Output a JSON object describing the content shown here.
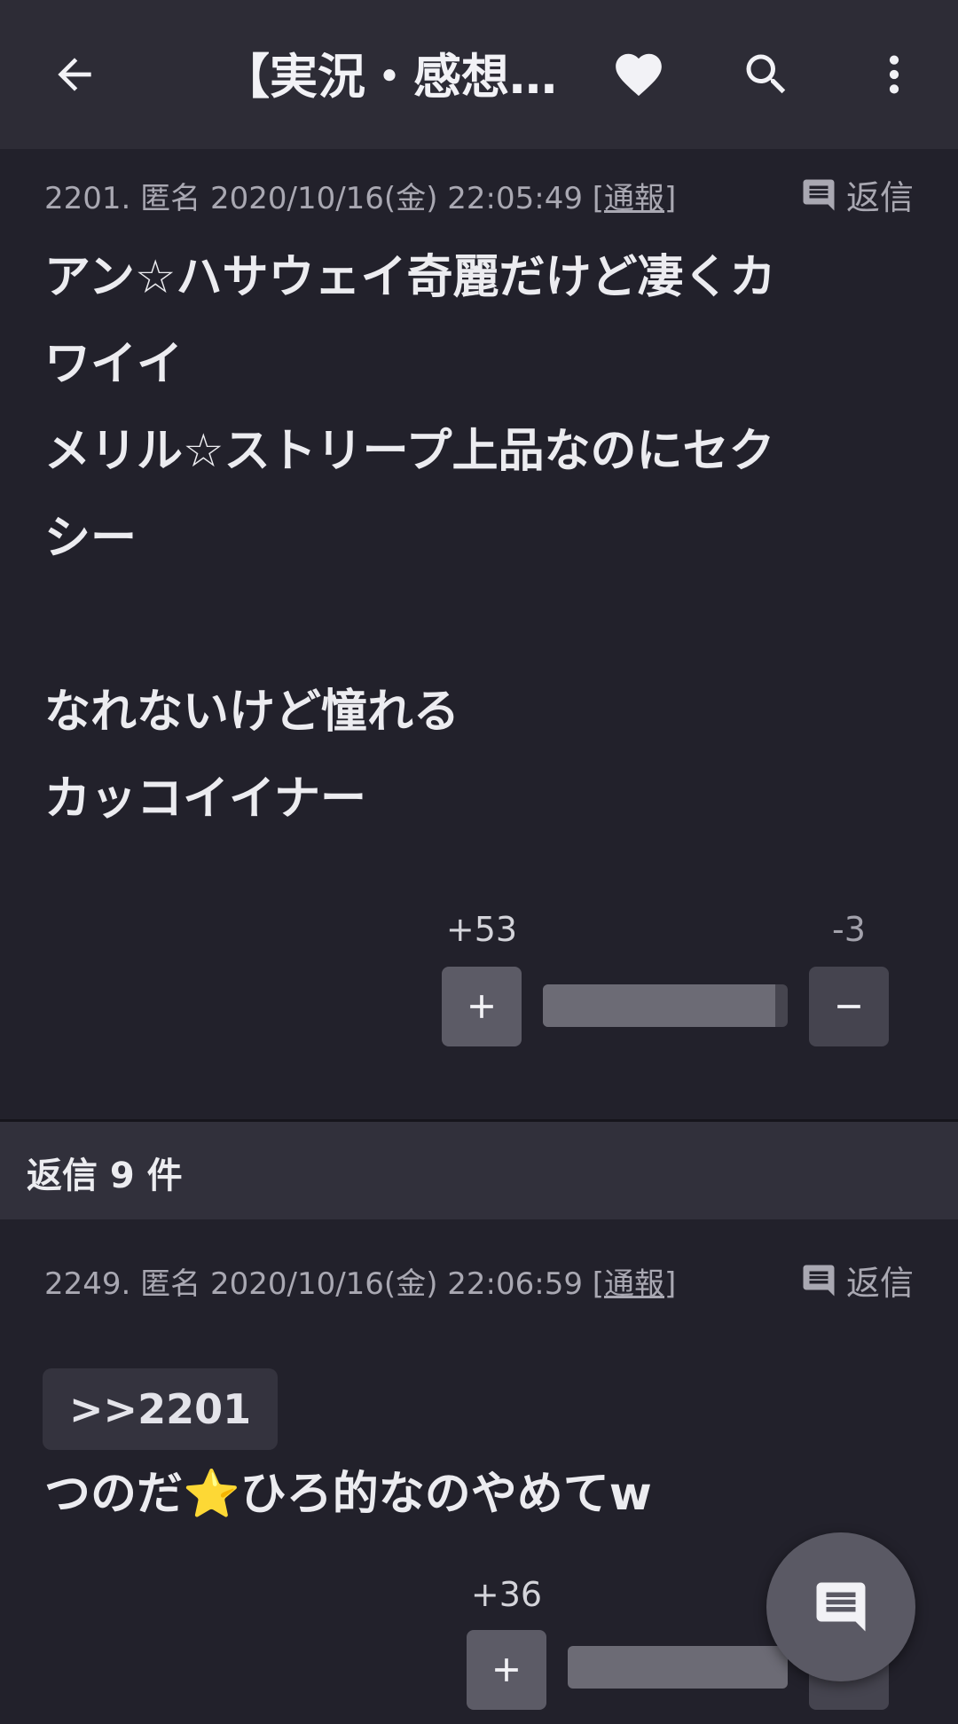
{
  "appbar": {
    "title": "【実況・感想…",
    "back_icon": "arrow-left-icon",
    "favorite_icon": "heart-icon",
    "search_icon": "search-icon",
    "more_icon": "more-vert-icon"
  },
  "posts": [
    {
      "number": "2201.",
      "author": "匿名",
      "datetime": "2020/10/16(金) 22:05:49",
      "report_label": "[通報]",
      "reply_label": "返信",
      "body": "アン☆ハサウェイ奇麗だけど凄くカ\nワイイ\nメリル☆ストリープ上品なのにセク\nシー\n\nなれないけど憧れる\nカッコイイナー",
      "upvotes": "+53",
      "downvotes": "-3",
      "upvote_ratio": 0.95
    },
    {
      "number": "2249.",
      "author": "匿名",
      "datetime": "2020/10/16(金) 22:06:59",
      "report_label": "[通報]",
      "reply_label": "返信",
      "quote": ">>2201",
      "body": "つのだ⭐ひろ的なのやめてw",
      "upvotes": "+36",
      "upvote_ratio": 1.0
    }
  ],
  "replies_section": {
    "label": "返信 9 件"
  },
  "fab": {
    "icon": "comment-icon"
  },
  "colors": {
    "background": "#22212b",
    "appbar": "#2d2c36",
    "text": "#ececf0",
    "muted": "#a9a8b2"
  }
}
